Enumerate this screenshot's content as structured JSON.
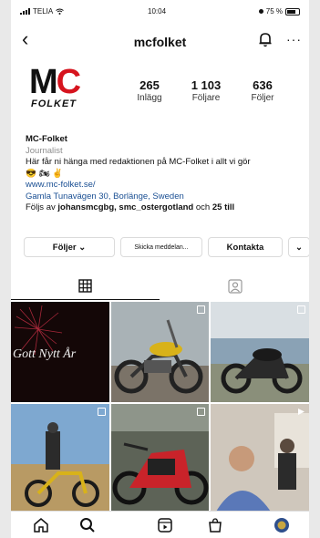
{
  "status": {
    "carrier": "TELIA",
    "time": "10:04",
    "battery": "75 %"
  },
  "nav": {
    "back": "‹",
    "username": "mcfolket",
    "more": "···"
  },
  "profile": {
    "logo_text": "MC",
    "logo_sub": "FOLKET",
    "stats": [
      {
        "value": "265",
        "label": "Inlägg"
      },
      {
        "value": "1 103",
        "label": "Följare"
      },
      {
        "value": "636",
        "label": "Följer"
      }
    ]
  },
  "bio": {
    "name": "MC-Folket",
    "category": "Journalist",
    "text": "Här får ni hänga med redaktionen på MC-Folket i allt vi gör",
    "emojis": "😎 🏍 ✌",
    "website": "www.mc-folket.se/",
    "address": "Gamla Tunavägen 30, Borlänge, Sweden",
    "followed_prefix": "Följs av ",
    "followed_names": "johansmcgbg, smc_ostergotland",
    "followed_mid": " och ",
    "followed_more": "25 till"
  },
  "actions": {
    "following": "Följer ⌄",
    "message": "Skicka meddelan...",
    "contact": "Kontakta",
    "more": "⌄"
  },
  "grid": {
    "first_post_text": "Gott Nytt År"
  },
  "colors": {
    "brand_red": "#d6141e",
    "link": "#1a4f93"
  }
}
